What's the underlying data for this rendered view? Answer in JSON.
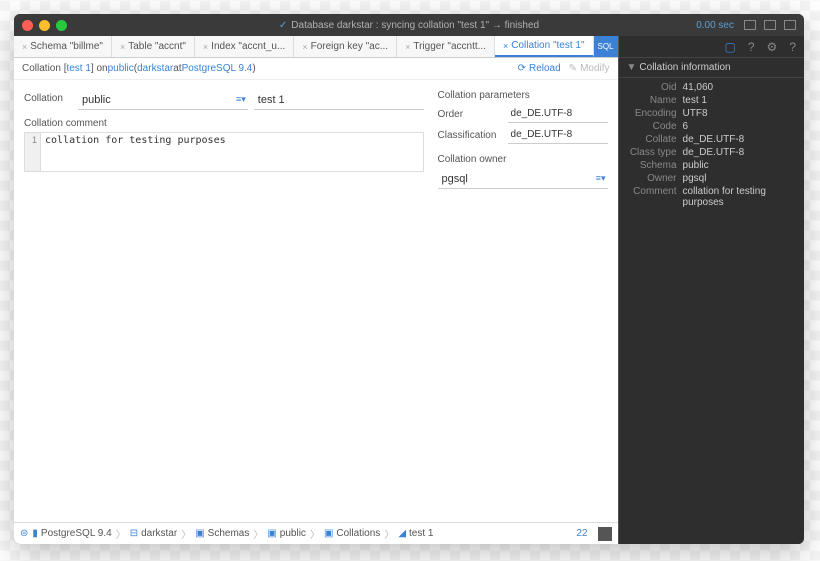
{
  "titlebar": {
    "status": "Database darkstar : syncing collation \"test 1\" → finished",
    "time": "0.00 sec"
  },
  "tabs": [
    {
      "label": "Schema \"billme\""
    },
    {
      "label": "Table \"accnt\""
    },
    {
      "label": "Index \"accnt_u..."
    },
    {
      "label": "Foreign key \"ac..."
    },
    {
      "label": "Trigger \"accntt..."
    },
    {
      "label": "Collation \"test 1\"",
      "active": true
    }
  ],
  "subheader": {
    "prefix": "Collation [ ",
    "name": "test 1",
    "mid1": " ] on ",
    "schema": "public",
    "mid2": " (",
    "db": "darkstar",
    "mid3": " at ",
    "server": "PostgreSQL 9.4",
    "suffix": ")",
    "reload": "Reload",
    "modify": "Modify"
  },
  "form": {
    "collation_label": "Collation",
    "schema_value": "public",
    "name_value": "test 1",
    "comment_label": "Collation comment",
    "comment_line": "1",
    "comment_value": "collation for testing purposes",
    "params_title": "Collation parameters",
    "order_label": "Order",
    "order_value": "de_DE.UTF-8",
    "class_label": "Classification",
    "class_value": "de_DE.UTF-8",
    "owner_title": "Collation owner",
    "owner_value": "pgsql"
  },
  "breadcrumb": {
    "items": [
      "PostgreSQL 9.4",
      "darkstar",
      "Schemas",
      "public",
      "Collations",
      "test 1"
    ],
    "count": "22"
  },
  "info": {
    "title": "Collation information",
    "rows": [
      {
        "label": "Oid",
        "value": "41,060"
      },
      {
        "label": "Name",
        "value": "test 1"
      },
      {
        "label": "Encoding",
        "value": "UTF8"
      },
      {
        "label": "Code",
        "value": "6"
      },
      {
        "label": "Collate",
        "value": "de_DE.UTF-8"
      },
      {
        "label": "Class type",
        "value": "de_DE.UTF-8"
      },
      {
        "label": "Schema",
        "value": "public"
      },
      {
        "label": "Owner",
        "value": "pgsql"
      },
      {
        "label": "Comment",
        "value": "collation for testing purposes"
      }
    ]
  }
}
